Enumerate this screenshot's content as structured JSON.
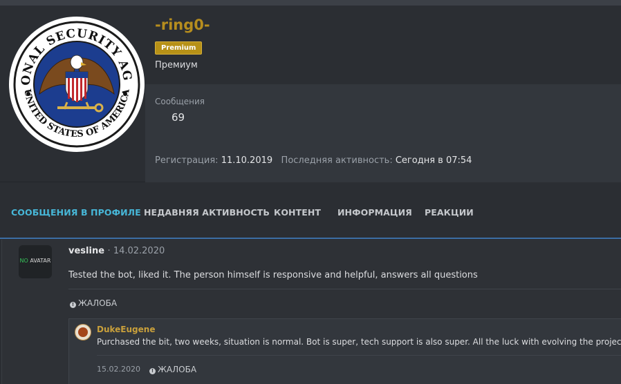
{
  "profile": {
    "username": "-ring0-",
    "badge": "Premium",
    "user_title": "Премиум",
    "avatar_seal_text": "NATIONAL SECURITY AGENCY • UNITED STATES OF AMERICA",
    "messages_label": "Сообщения",
    "messages_count": "69",
    "registration_label": "Регистрация:",
    "registration_date": "11.10.2019",
    "last_activity_label": "Последняя активность:",
    "last_activity_value": "Сегодня в 07:54"
  },
  "tabs": [
    {
      "label": "СООБЩЕНИЯ В ПРОФИЛЕ",
      "active": true
    },
    {
      "label": "НЕДАВНЯЯ АКТИВНОСТЬ",
      "active": false
    },
    {
      "label": "КОНТЕНТ",
      "active": false
    },
    {
      "label": "ИНФОРМАЦИЯ",
      "active": false
    },
    {
      "label": "РЕАКЦИИ",
      "active": false
    }
  ],
  "post": {
    "avatar_text_a": "NO",
    "avatar_text_b": "AVATAR",
    "author": "vesline",
    "date": "14.02.2020",
    "text": "Tested the bot, liked it. The person himself is responsive and helpful, answers all questions",
    "report_label": "ЖАЛОБА"
  },
  "comment": {
    "author": "DukeEugene",
    "text": "Purchased the bit, two weeks, situation is normal. Bot is super, tech support is also super. All the luck with evolving the project",
    "date": "15.02.2020",
    "report_label": "ЖАЛОБА"
  },
  "colors": {
    "username": "#b68d1e",
    "badge_bg": "#b79117",
    "active_tab": "#47b7d8",
    "tab_underline": "#3b6ea5",
    "comment_author": "#c9a03b",
    "no_avatar_accent": "#36c35a"
  }
}
